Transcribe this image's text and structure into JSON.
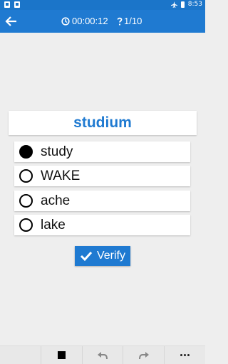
{
  "status_bar": {
    "time": "8:53"
  },
  "app_bar": {
    "timer": "00:00:12",
    "progress": "1/10"
  },
  "quiz": {
    "word": "studium",
    "options": [
      {
        "label": "study",
        "selected": true
      },
      {
        "label": "WAKE",
        "selected": false
      },
      {
        "label": "ache",
        "selected": false
      },
      {
        "label": "lake",
        "selected": false
      }
    ],
    "verify_label": "Verify"
  },
  "colors": {
    "primary": "#1f7ad1",
    "status_bar": "#1b75c9",
    "background": "#eeeeee"
  },
  "icons": {
    "back": "arrow-left-icon",
    "timer": "clock-icon",
    "progress": "question-mark-icon",
    "verify": "check-icon",
    "stop": "stop-icon",
    "undo": "undo-icon",
    "redo": "redo-icon",
    "more": "more-horizontal-icon"
  }
}
